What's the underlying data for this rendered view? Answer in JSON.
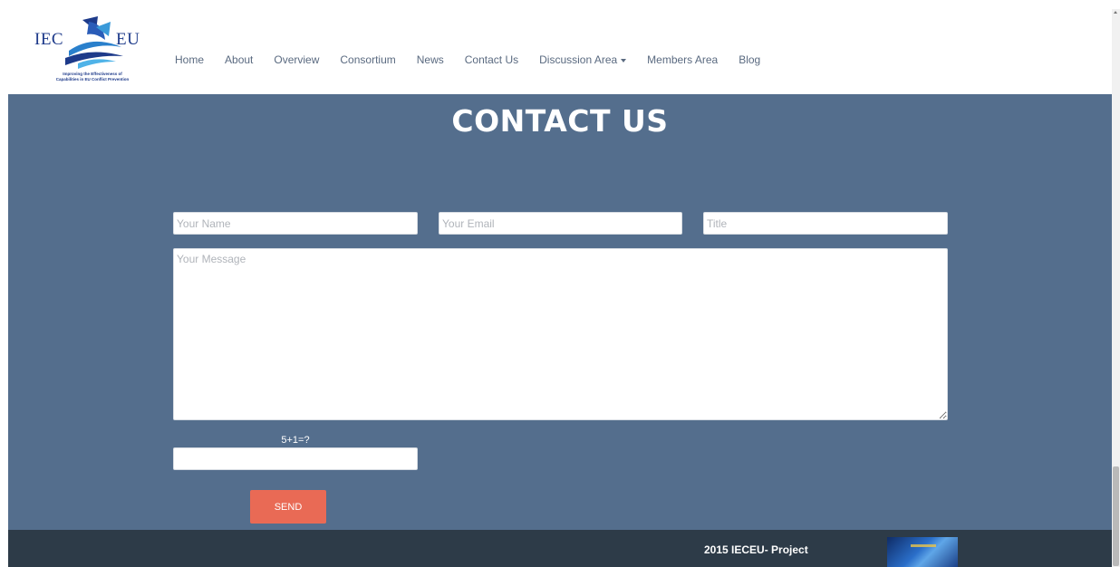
{
  "header": {
    "logo": {
      "left_text": "IEC",
      "right_text": "EU",
      "tagline_line1": "Improving the Effectiveness of",
      "tagline_line2": "Capabilities in EU Conflict Prevention"
    },
    "nav": [
      {
        "label": "Home"
      },
      {
        "label": "About"
      },
      {
        "label": "Overview"
      },
      {
        "label": "Consortium"
      },
      {
        "label": "News"
      },
      {
        "label": "Contact Us"
      },
      {
        "label": "Discussion Area",
        "has_dropdown": true
      },
      {
        "label": "Members Area"
      },
      {
        "label": "Blog"
      }
    ]
  },
  "main": {
    "title": "CONTACT US",
    "form": {
      "name_placeholder": "Your Name",
      "email_placeholder": "Your Email",
      "title_placeholder": "Title",
      "message_placeholder": "Your Message",
      "captcha_label": "5+1=?",
      "send_label": "SEND"
    }
  },
  "footer": {
    "text": "2015 IECEU- Project"
  },
  "colors": {
    "background": "#546e8d",
    "send_button": "#e96a55",
    "footer": "#2d3b48",
    "nav_text": "#5a6a80"
  }
}
